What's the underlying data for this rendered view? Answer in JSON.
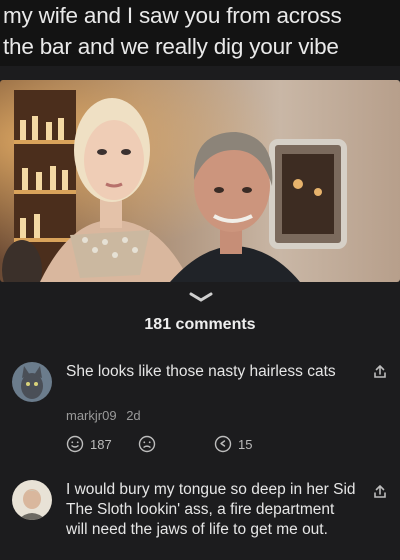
{
  "caption": {
    "line1": "my wife and I saw you from across",
    "line2": "the bar and we really dig your vibe"
  },
  "comments_header": "181 comments",
  "comments": [
    {
      "text": "She looks like those nasty hairless cats",
      "author": "markjr09",
      "time": "2d",
      "likes": "187",
      "replies": "15"
    },
    {
      "text": "I would bury my tongue so deep in her Sid The Sloth lookin' ass, a fire department will need the jaws of life to get me out."
    }
  ],
  "icons": {
    "grabber": "chevron-down-icon",
    "share": "share-icon",
    "like": "smile-icon",
    "dislike": "frown-icon",
    "reply": "reply-icon"
  },
  "colors": {
    "background": "#1c1c1e",
    "caption_bg": "#131313",
    "text": "#e6e6e6",
    "muted": "#9a9a9a"
  }
}
